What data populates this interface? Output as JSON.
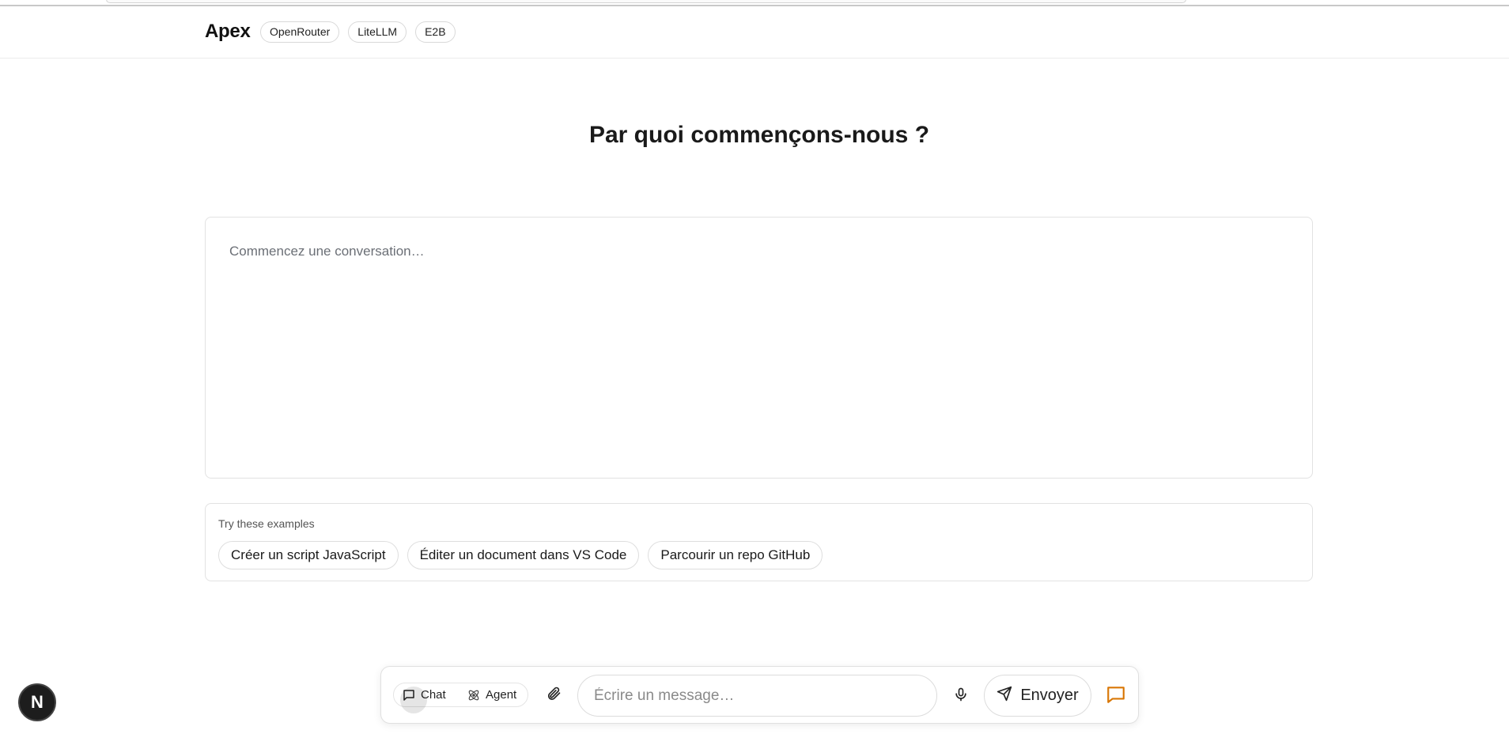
{
  "header": {
    "brand": "Apex",
    "badges": [
      "OpenRouter",
      "LiteLLM",
      "E2B"
    ]
  },
  "main": {
    "title": "Par quoi commençons-nous ?",
    "composer_placeholder": "Commencez une conversation…"
  },
  "examples": {
    "title": "Try these examples",
    "items": [
      "Créer un script JavaScript",
      "Éditer un document dans VS Code",
      "Parcourir un repo GitHub"
    ]
  },
  "bottom_bar": {
    "modes": [
      {
        "label": "Chat",
        "icon": "message-square-icon",
        "selected": true
      },
      {
        "label": "Agent",
        "icon": "atom-icon",
        "selected": false
      }
    ],
    "attach_icon": "paperclip-icon",
    "input_placeholder": "Écrire un message…",
    "mic_icon": "microphone-icon",
    "send_label": "Envoyer",
    "send_icon": "send-icon",
    "chat_icon": "chat-bubble-icon",
    "accent_color": "#d97706"
  },
  "floating": {
    "badge_letter": "N"
  }
}
